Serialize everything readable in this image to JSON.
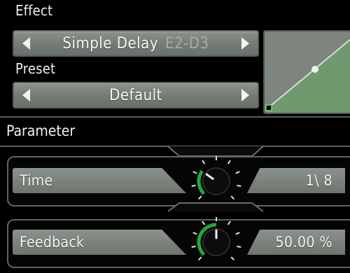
{
  "effect": {
    "label": "Effect",
    "name": "Simple Delay",
    "range": "E2-D3"
  },
  "preset": {
    "label": "Preset",
    "name": "Default"
  },
  "parameter": {
    "header": "Parameter",
    "rows": [
      {
        "label": "Time",
        "value": "1\\ 8",
        "knob_level": 0.3
      },
      {
        "label": "Feedback",
        "value": "50.00 %",
        "knob_level": 0.5
      }
    ]
  },
  "colors": {
    "panel_gray": "#7e857e",
    "curve_fill": "#6f9a6f",
    "knob_arc": "#1fa83a",
    "point": "#f2f2f2"
  },
  "icons": {
    "prev": "triangle-left",
    "next": "triangle-right"
  }
}
